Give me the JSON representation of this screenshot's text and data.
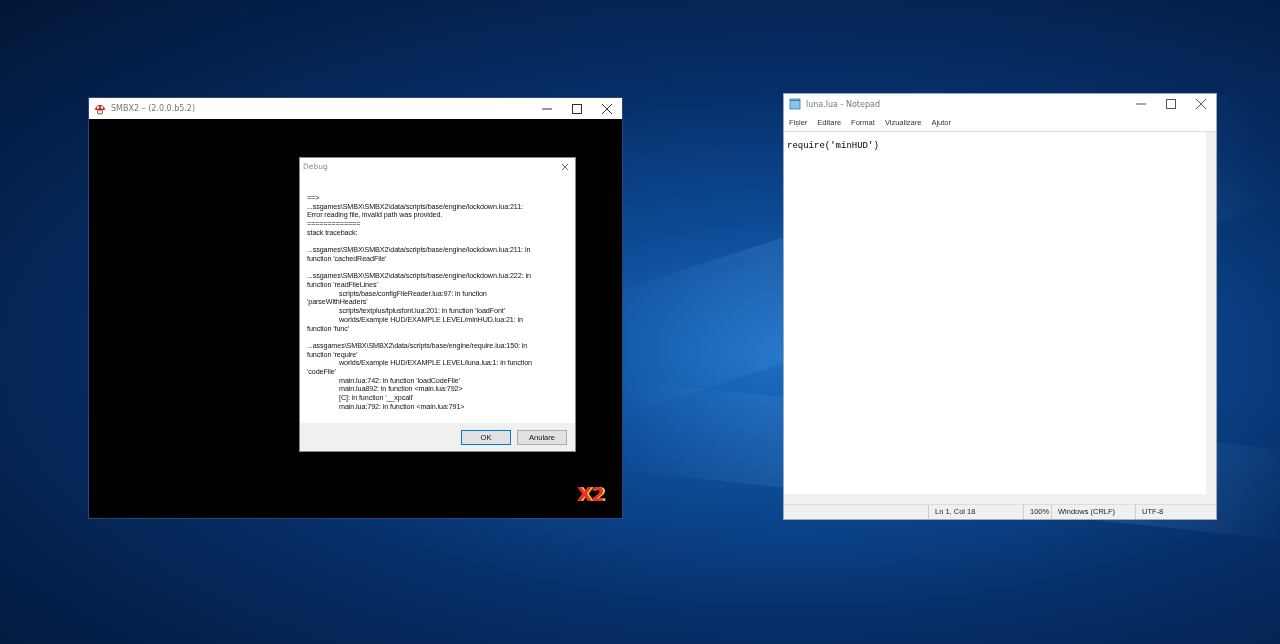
{
  "game_window": {
    "title": "SMBX2 – (2.0.0.b5.2)",
    "logo": "X2"
  },
  "debug_dialog": {
    "title": "Debug",
    "blocks": [
      [
        {
          "text": "==>",
          "indent": false
        },
        {
          "text": "...ssgames\\SMBX\\SMBX2\\data/scripts/base/engine/lockdown.lua:211:",
          "indent": false
        },
        {
          "text": "Error reading file, invalid path was provided.",
          "indent": false
        },
        {
          "text": "=============",
          "indent": false
        },
        {
          "text": "stack traceback:",
          "indent": false
        }
      ],
      [
        {
          "text": "...ssgames\\SMBX\\SMBX2\\data/scripts/base/engine/lockdown.lua:211: in",
          "indent": false
        },
        {
          "text": "function 'cachedReadFile'",
          "indent": false
        }
      ],
      [
        {
          "text": "...ssgames\\SMBX\\SMBX2\\data/scripts/base/engine/lockdown.lua:222: in",
          "indent": false
        },
        {
          "text": "function 'readFileLines'",
          "indent": false
        },
        {
          "text": "scripts/base/configFileReader.lua:97: in function",
          "indent": true
        },
        {
          "text": "'parseWithHeaders'",
          "indent": false
        },
        {
          "text": "scripts/textplus/tplusfont.lua:201: in function 'loadFont'",
          "indent": true
        },
        {
          "text": "worlds/Example HUD/EXAMPLE LEVEL/minHUD.lua:21: in",
          "indent": true
        },
        {
          "text": "function 'func'",
          "indent": false
        }
      ],
      [
        {
          "text": "...assgames\\SMBX\\SMBX2\\data/scripts/base/engine/require.lua:150: in",
          "indent": false
        },
        {
          "text": "function 'require'",
          "indent": false
        },
        {
          "text": "worlds/Example HUD/EXAMPLE LEVEL/luna.lua:1: in function",
          "indent": true
        },
        {
          "text": "'codeFile'",
          "indent": false
        },
        {
          "text": "main.lua:742: in function 'loadCodeFile'",
          "indent": true
        },
        {
          "text": "main.lua892: in function <main.lua:792>",
          "indent": true
        },
        {
          "text": "[C]: in function '__xpcall'",
          "indent": true
        },
        {
          "text": "main.lua:792: in function <main.lua:791>",
          "indent": true
        }
      ]
    ],
    "buttons": [
      "OK",
      "Anulare"
    ]
  },
  "notepad": {
    "title": "luna.lua - Notepad",
    "menu": [
      "Fișier",
      "Editare",
      "Format",
      "Vizualizare",
      "Ajutor"
    ],
    "content": "require('minHUD')",
    "status_bar": [
      "Ln 1, Col 18",
      "100%",
      "Windows (CRLF)",
      "UTF-8"
    ]
  }
}
